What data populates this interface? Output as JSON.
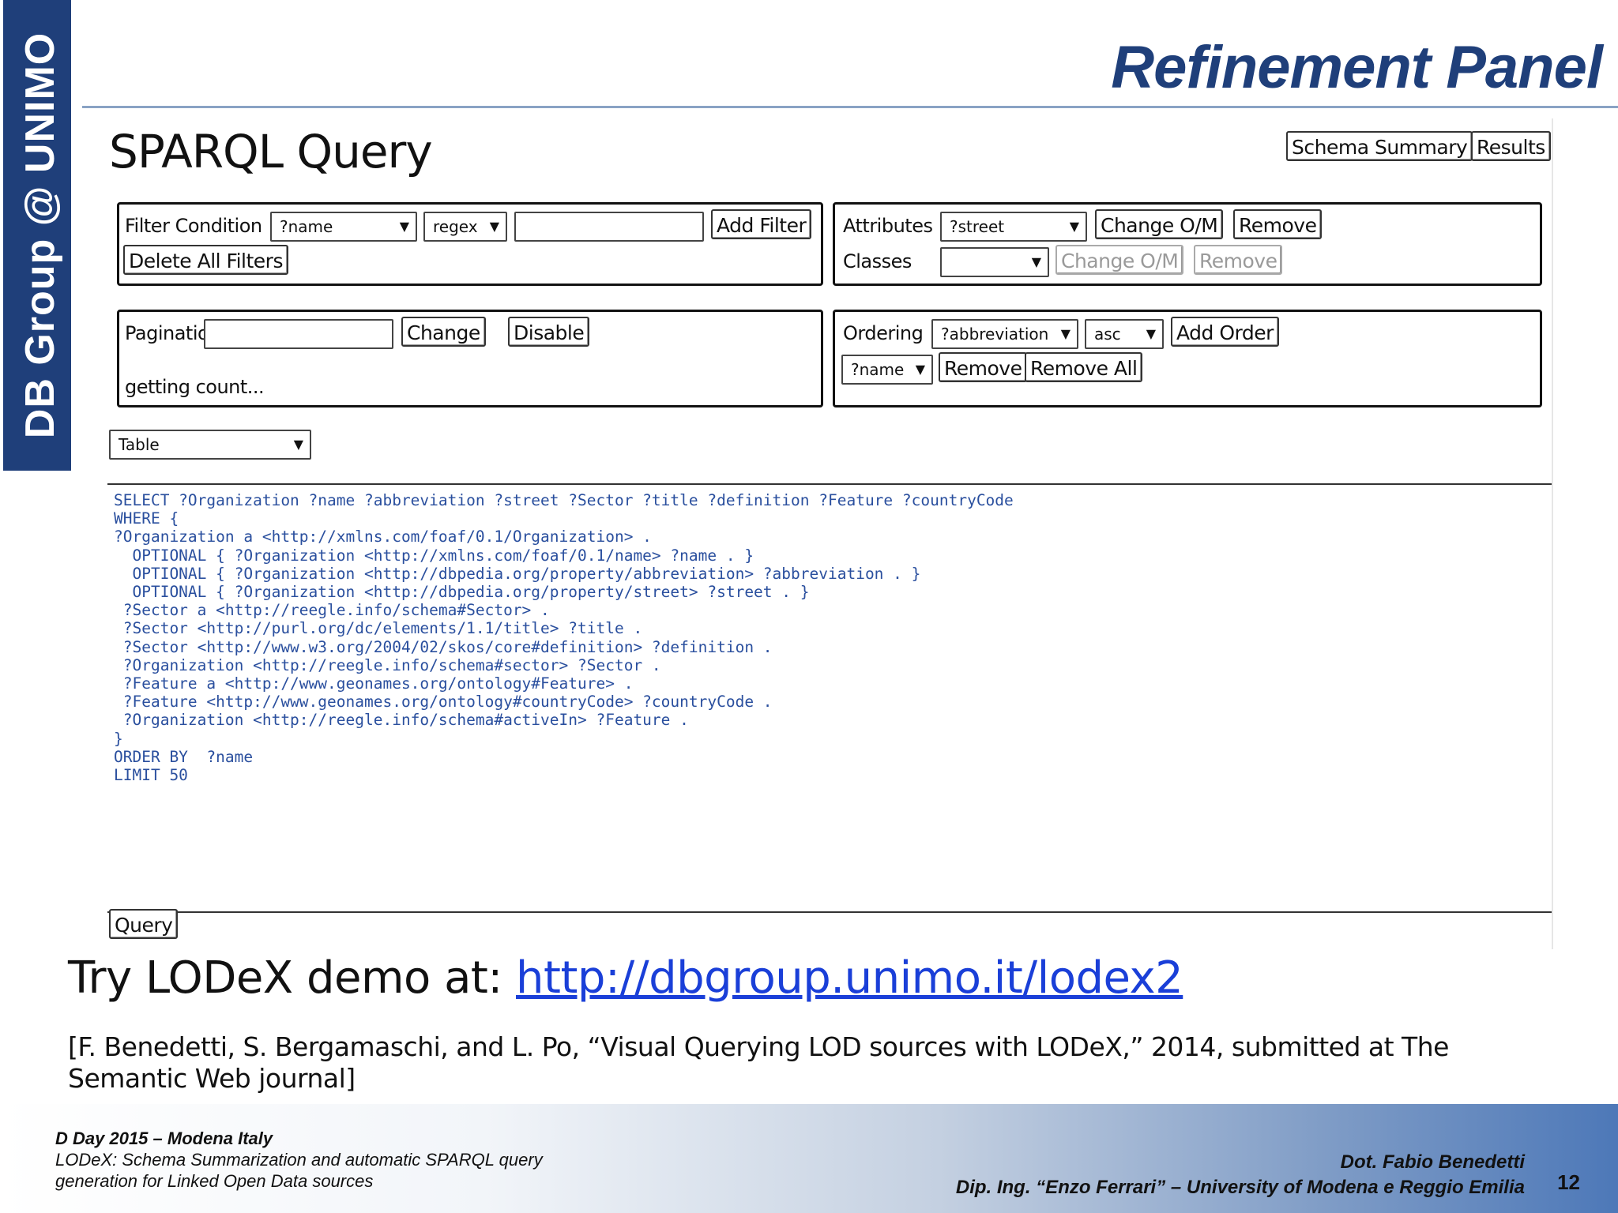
{
  "slide": {
    "side_label": "DB Group @ UNIMO",
    "title": "Refinement Panel"
  },
  "app": {
    "title": "SPARQL Query",
    "top_buttons": {
      "schema_summary": "Schema Summary",
      "results": "Results"
    },
    "filter": {
      "label": "Filter Condition",
      "field_value": "?name",
      "operator_value": "regex",
      "input_value": "",
      "add_filter": "Add Filter",
      "delete_all": "Delete All Filters"
    },
    "attributes": {
      "label": "Attributes",
      "value": "?street",
      "change_om": "Change O/M",
      "remove": "Remove"
    },
    "classes": {
      "label": "Classes",
      "value": "",
      "change_om": "Change O/M",
      "remove": "Remove"
    },
    "pagination": {
      "label": "Pagination",
      "input_value": "",
      "change": "Change",
      "disable": "Disable",
      "status": "getting count..."
    },
    "ordering": {
      "label": "Ordering",
      "field_value": "?abbreviation",
      "direction_value": "asc",
      "add_order": "Add Order",
      "current_value": "?name",
      "remove": "Remove",
      "remove_all": "Remove All"
    },
    "view_select": {
      "value": "Table"
    },
    "query_lines": [
      "SELECT ?Organization ?name ?abbreviation ?street ?Sector ?title ?definition ?Feature ?countryCode",
      "WHERE {",
      "?Organization a <http://xmlns.com/foaf/0.1/Organization> .",
      "  OPTIONAL { ?Organization <http://xmlns.com/foaf/0.1/name> ?name . }",
      "  OPTIONAL { ?Organization <http://dbpedia.org/property/abbreviation> ?abbreviation . }",
      "  OPTIONAL { ?Organization <http://dbpedia.org/property/street> ?street . }",
      " ?Sector a <http://reegle.info/schema#Sector> .",
      " ?Sector <http://purl.org/dc/elements/1.1/title> ?title .",
      " ?Sector <http://www.w3.org/2004/02/skos/core#definition> ?definition .",
      " ?Organization <http://reegle.info/schema#sector> ?Sector .",
      " ?Feature a <http://www.geonames.org/ontology#Feature> .",
      " ?Feature <http://www.geonames.org/ontology#countryCode> ?countryCode .",
      " ?Organization <http://reegle.info/schema#activeIn> ?Feature .",
      "}",
      "ORDER BY  ?name",
      "LIMIT 50"
    ],
    "query_button": "Query"
  },
  "demo": {
    "prefix": "Try LODeX demo at: ",
    "link": "http://dbgroup.unimo.it/lodex2"
  },
  "citation": "[F. Benedetti, S. Bergamaschi, and L. Po, “Visual Querying LOD sources with LODeX,” 2014, submitted at The Semantic Web journal]",
  "footer": {
    "event": "D Day 2015 – Modena Italy",
    "talk_line1": "LODeX: Schema Summarization and automatic SPARQL query",
    "talk_line2": "generation for Linked Open Data sources",
    "author": "Dot. Fabio Benedetti",
    "affiliation": "Dip. Ing. “Enzo Ferrari” – University of Modena e Reggio Emilia",
    "page_number": "12"
  },
  "colors": {
    "brand_blue": "#1f3f7a",
    "code_blue": "#2a4f9e",
    "link_blue": "#1a3fd8"
  },
  "icons": {
    "dropdown": "chevron-down-icon"
  }
}
